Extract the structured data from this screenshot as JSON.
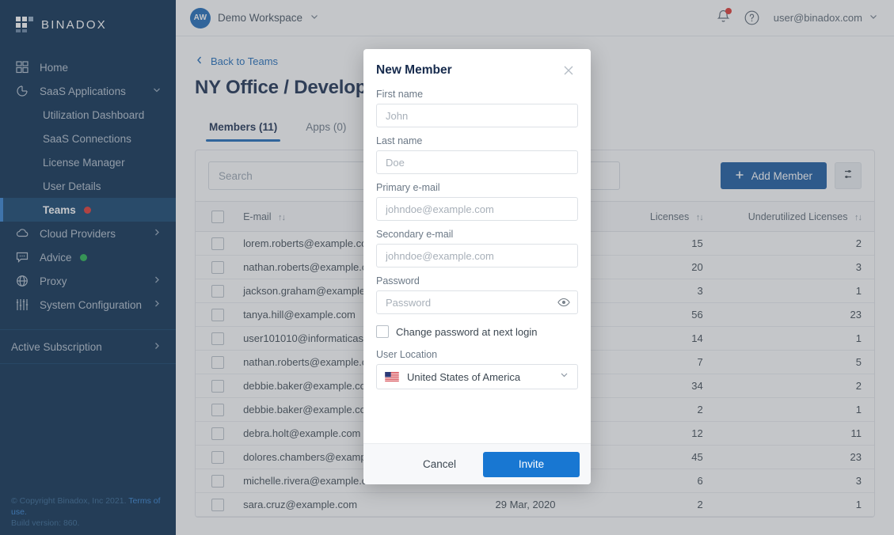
{
  "sidebar": {
    "brand": "BINADOX",
    "items": [
      {
        "label": "Home",
        "icon": "grid-icon",
        "level": 0,
        "chevron": "",
        "badge": ""
      },
      {
        "label": "SaaS Applications",
        "icon": "pie-chart-icon",
        "level": 0,
        "chevron": "down",
        "badge": ""
      },
      {
        "label": "Utilization Dashboard",
        "icon": "",
        "level": 1,
        "chevron": "",
        "badge": ""
      },
      {
        "label": "SaaS Connections",
        "icon": "",
        "level": 1,
        "chevron": "",
        "badge": ""
      },
      {
        "label": "License Manager",
        "icon": "",
        "level": 1,
        "chevron": "",
        "badge": ""
      },
      {
        "label": "User Details",
        "icon": "",
        "level": 1,
        "chevron": "",
        "badge": ""
      },
      {
        "label": "Teams",
        "icon": "",
        "level": 1,
        "chevron": "",
        "badge": "red",
        "active": true
      },
      {
        "label": "Cloud Providers",
        "icon": "cloud-icon",
        "level": 0,
        "chevron": "right",
        "badge": ""
      },
      {
        "label": "Advice",
        "icon": "chat-icon",
        "level": 0,
        "chevron": "",
        "badge": "green"
      },
      {
        "label": "Proxy",
        "icon": "globe-icon",
        "level": 0,
        "chevron": "right",
        "badge": ""
      },
      {
        "label": "System Configuration",
        "icon": "sliders-icon",
        "level": 0,
        "chevron": "right",
        "badge": ""
      }
    ],
    "subscription": {
      "label": "Active Subscription",
      "chevron": "right"
    },
    "footer_copyright": "© Copyright Binadox, Inc 2021.",
    "footer_terms": "Terms of use.",
    "footer_build": "Build version: 860."
  },
  "topbar": {
    "workspace_initials": "AW",
    "workspace_name": "Demo Workspace",
    "user_email": "user@binadox.com"
  },
  "page": {
    "back_link": "Back to Teams",
    "title": "NY Office / Development",
    "tabs": [
      {
        "label": "Members (11)",
        "active": true
      },
      {
        "label": "Apps (0)",
        "active": false
      }
    ]
  },
  "toolbar": {
    "search_placeholder": "Search",
    "search_value": "",
    "add_member_label": "Add Member",
    "settings_icon": "table-settings-icon"
  },
  "table": {
    "columns": [
      "",
      "E-mail",
      "",
      "Licenses",
      "Underutilized Licenses"
    ],
    "rows": [
      {
        "email": "lorem.roberts@example.com",
        "date": "",
        "licenses": "15",
        "underutilized": "2"
      },
      {
        "email": "nathan.roberts@example.com",
        "date": "",
        "licenses": "20",
        "underutilized": "3"
      },
      {
        "email": "jackson.graham@example.com",
        "date": "",
        "licenses": "3",
        "underutilized": "1"
      },
      {
        "email": "tanya.hill@example.com",
        "date": "",
        "licenses": "56",
        "underutilized": "23"
      },
      {
        "email": "user101010@informaticas.com",
        "date": "",
        "licenses": "14",
        "underutilized": "1"
      },
      {
        "email": "nathan.roberts@example.com",
        "date": "",
        "licenses": "7",
        "underutilized": "5"
      },
      {
        "email": "debbie.baker@example.com",
        "date": "",
        "licenses": "34",
        "underutilized": "2"
      },
      {
        "email": "debbie.baker@example.com",
        "date": "",
        "licenses": "2",
        "underutilized": "1"
      },
      {
        "email": "debra.holt@example.com",
        "date": "",
        "licenses": "12",
        "underutilized": "11"
      },
      {
        "email": "dolores.chambers@example.com",
        "date": "",
        "licenses": "45",
        "underutilized": "23"
      },
      {
        "email": "michelle.rivera@example.com",
        "date": "",
        "licenses": "6",
        "underutilized": "3"
      },
      {
        "email": "sara.cruz@example.com",
        "date": "29 Mar, 2020",
        "licenses": "2",
        "underutilized": "1"
      }
    ]
  },
  "modal": {
    "title": "New Member",
    "close_icon": "close-icon",
    "fields": {
      "first_name_label": "First name",
      "first_name_placeholder": "John",
      "first_name_value": "",
      "last_name_label": "Last name",
      "last_name_placeholder": "Doe",
      "last_name_value": "",
      "primary_email_label": "Primary e-mail",
      "primary_email_placeholder": "johndoe@example.com",
      "primary_email_value": "",
      "secondary_email_label": "Secondary e-mail",
      "secondary_email_placeholder": "johndoe@example.com",
      "secondary_email_value": "",
      "password_label": "Password",
      "password_placeholder": "Password",
      "password_value": "",
      "change_password_label": "Change password at next login",
      "change_password_checked": false,
      "user_location_label": "User Location",
      "user_location_value": "United States of America",
      "user_location_flag": "us-flag-icon"
    },
    "cancel_label": "Cancel",
    "invite_label": "Invite"
  },
  "colors": {
    "sidebar_bg": "#052a4e",
    "accent_blue": "#1a68b8",
    "primary_button": "#15579f",
    "invite_button": "#1877d2",
    "badge_red": "#e0322d",
    "badge_green": "#22b14c"
  }
}
